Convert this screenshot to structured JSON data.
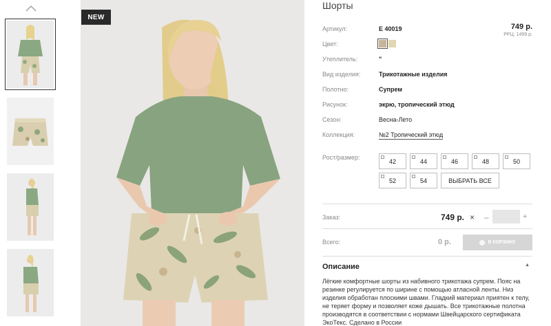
{
  "badge": "NEW",
  "product": {
    "title": "Шорты",
    "price": "749 р.",
    "rrc": "PPЦ: 1499 р.",
    "attributes": [
      {
        "label": "Артикул:",
        "value": "E 40019"
      },
      {
        "label": "Цвет:",
        "value": ""
      },
      {
        "label": "Утеплитель:",
        "value": "\""
      },
      {
        "label": "Вид изделия:",
        "value": "Трикотажные изделия"
      },
      {
        "label": "Полотно:",
        "value": "Супрем"
      },
      {
        "label": "Рисунок:",
        "value": "экрю, тропический этюд"
      },
      {
        "label": "Сезон:",
        "value": "Весна-Лето"
      },
      {
        "label": "Коллекция:",
        "value": "№2 Тропический этюд"
      }
    ],
    "colors": [
      "#c7b69a",
      "#e3d6b2"
    ]
  },
  "sizes": {
    "label": "Рост/размер:",
    "options": [
      "42",
      "44",
      "46",
      "48",
      "50",
      "52",
      "54"
    ],
    "select_all": "ВЫБРАТЬ ВСЕ"
  },
  "order": {
    "label": "Заказ:",
    "price": "749 р.",
    "multiply": "×",
    "minus": "–",
    "plus": "+"
  },
  "total": {
    "label": "Всего:",
    "value": "0 р.",
    "cart_button": "В КОРЗИНУ"
  },
  "description": {
    "title": "Описание",
    "toggle": "▲",
    "text": "Лёгкие комфортные шорты из набивного трикотажа супрем. Пояс на резинке регулируется по ширине с помощью атласной ленты. Низ изделия обработан плоскими швами. Гладкий материал приятен к телу, не теряет форму и позволяет коже дышать. Все трикотажные полотна производятся в соответствии с нормами Швейцарского сертификата ЭкоТекс. Сделано в России"
  },
  "icons": {
    "thumb_up": "chevron-up-icon",
    "x": "close-icon",
    "cart": "cart-icon"
  }
}
